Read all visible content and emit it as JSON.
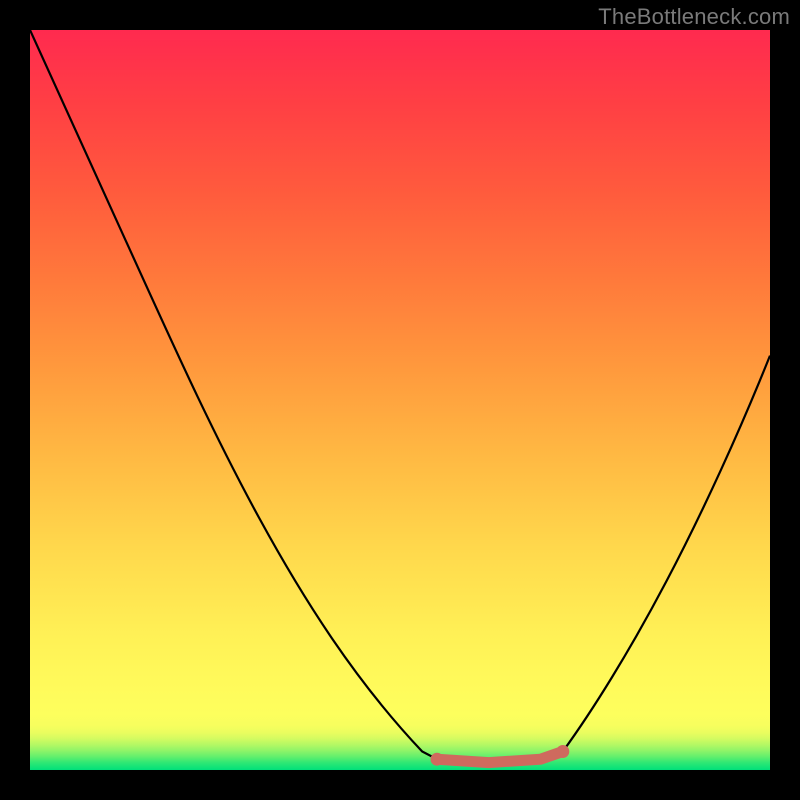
{
  "watermark": "TheBottleneck.com",
  "colors": {
    "background_frame": "#000000",
    "curve": "#000000",
    "highlight": "#cf6a5e",
    "gradient_top": "#ff2a4f",
    "gradient_mid": "#ffe055",
    "gradient_bottom": "#00e07a"
  },
  "chart_data": {
    "type": "line",
    "title": "",
    "xlabel": "",
    "ylabel": "",
    "xlim": [
      0,
      100
    ],
    "ylim": [
      0,
      100
    ],
    "grid": false,
    "legend": false,
    "gradient_stops": [
      {
        "pos": 0.0,
        "color": "#00e07a"
      },
      {
        "pos": 0.01,
        "color": "#2fe874"
      },
      {
        "pos": 0.018,
        "color": "#62ef6d"
      },
      {
        "pos": 0.026,
        "color": "#8ef468"
      },
      {
        "pos": 0.034,
        "color": "#b3f864"
      },
      {
        "pos": 0.042,
        "color": "#d2fb61"
      },
      {
        "pos": 0.05,
        "color": "#e9fd5f"
      },
      {
        "pos": 0.06,
        "color": "#f7fe5e"
      },
      {
        "pos": 0.075,
        "color": "#fdff5d"
      },
      {
        "pos": 0.11,
        "color": "#fffb5b"
      },
      {
        "pos": 0.18,
        "color": "#fff156"
      },
      {
        "pos": 0.3,
        "color": "#ffd84c"
      },
      {
        "pos": 0.42,
        "color": "#ffba43"
      },
      {
        "pos": 0.54,
        "color": "#ff9a3d"
      },
      {
        "pos": 0.66,
        "color": "#ff7a3b"
      },
      {
        "pos": 0.78,
        "color": "#ff5b3d"
      },
      {
        "pos": 0.9,
        "color": "#ff3f44"
      },
      {
        "pos": 1.0,
        "color": "#ff2a4f"
      }
    ],
    "series": [
      {
        "name": "bottleneck-curve",
        "points": [
          {
            "x": 0,
            "y": 100
          },
          {
            "x": 6,
            "y": 87
          },
          {
            "x": 11,
            "y": 76
          },
          {
            "x": 15,
            "y": 67
          },
          {
            "x": 20,
            "y": 56
          },
          {
            "x": 25,
            "y": 45
          },
          {
            "x": 31,
            "y": 34
          },
          {
            "x": 37,
            "y": 23
          },
          {
            "x": 44,
            "y": 12
          },
          {
            "x": 53,
            "y": 2.5
          },
          {
            "x": 55,
            "y": 1.5
          },
          {
            "x": 62,
            "y": 1.0
          },
          {
            "x": 69,
            "y": 1.5
          },
          {
            "x": 72,
            "y": 2.5
          },
          {
            "x": 76,
            "y": 8
          },
          {
            "x": 81,
            "y": 16
          },
          {
            "x": 86,
            "y": 25.5
          },
          {
            "x": 91,
            "y": 35
          },
          {
            "x": 96,
            "y": 46
          },
          {
            "x": 100,
            "y": 56
          }
        ]
      }
    ],
    "highlight_range": {
      "name": "optimal-range",
      "color": "#cf6a5e",
      "points": [
        {
          "x": 55,
          "y": 1.5
        },
        {
          "x": 62,
          "y": 1.0
        },
        {
          "x": 69,
          "y": 1.5
        },
        {
          "x": 72,
          "y": 2.5
        }
      ]
    }
  }
}
